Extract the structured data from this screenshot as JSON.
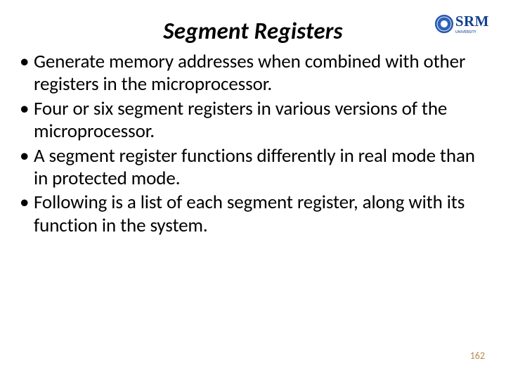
{
  "title": "Segment Registers",
  "logo": {
    "main": "SRM",
    "sub": "UNIVERSITY"
  },
  "bullets": [
    "Generate memory addresses when combined with other registers in the microprocessor.",
    "Four or six segment registers in various versions of the microprocessor.",
    "A segment register functions differently in real mode than in protected mode.",
    "Following is a list of each segment register, along with its function in the system."
  ],
  "page_number": "162"
}
